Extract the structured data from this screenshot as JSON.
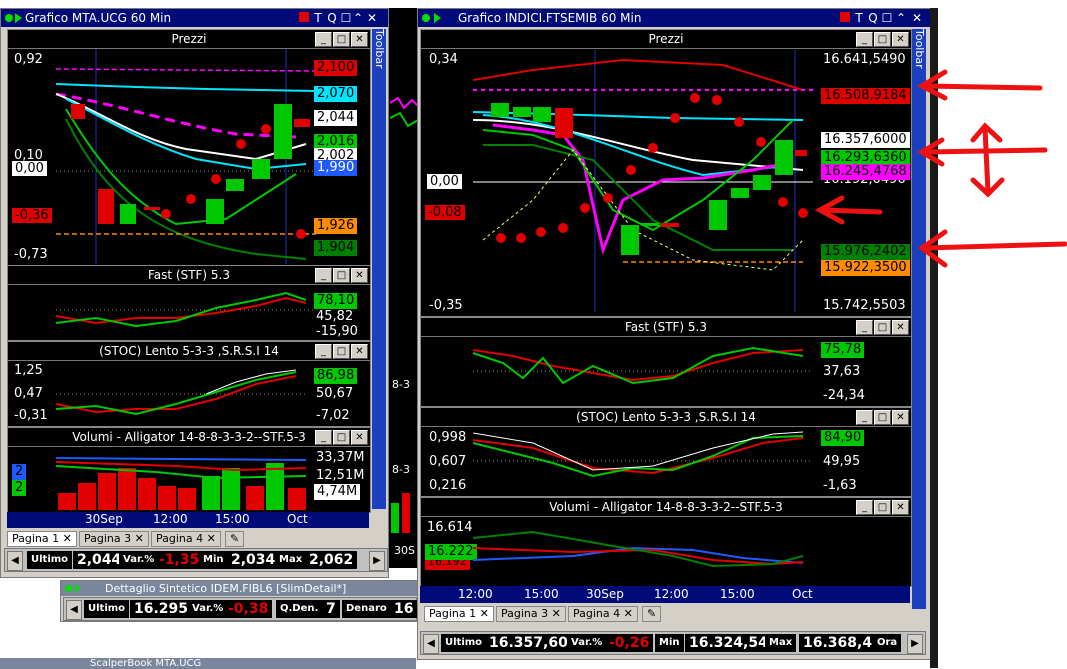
{
  "left_window": {
    "title": "Grafico MTA.UCG 60 Min",
    "title_buttons": [
      "T",
      "Q"
    ],
    "toolbar_label": "Toolbar",
    "price_pane": {
      "title": "Prezzi",
      "left_ticks": [
        "0,92",
        "0,10",
        "0,00",
        "-0,36",
        "-0,73"
      ],
      "right_tags": [
        {
          "text": "2,100",
          "bg": "#e00000",
          "fg": "#000000"
        },
        {
          "text": "2,070",
          "bg": "#00e5ff",
          "fg": "#000000"
        },
        {
          "text": "2,044",
          "bg": "#ffffff",
          "fg": "#000000"
        },
        {
          "text": "2,016",
          "bg": "#00c800",
          "fg": "#000000"
        },
        {
          "text": "2,002",
          "bg": "#ffffff",
          "fg": "#000000"
        },
        {
          "text": "1,990",
          "bg": "#1e5aff",
          "fg": "#ffffff"
        },
        {
          "text": "1,926",
          "bg": "#ff8c00",
          "fg": "#000000"
        },
        {
          "text": "1,904",
          "bg": "#008000",
          "fg": "#000000"
        }
      ]
    },
    "fast_pane": {
      "title": "Fast  (STF)   5.3",
      "right": [
        "78,10",
        "45,82",
        "-15,90"
      ]
    },
    "stoc_pane": {
      "title": "(STOC) Lento    5-3-3  ,S.R.S.I 14",
      "left": [
        "1,25",
        "0,47",
        "-0,31"
      ],
      "right": [
        "86,98",
        "50,67",
        "-7,02"
      ]
    },
    "vol_pane": {
      "title": "Volumi - Alligator 14-8-8-3-3-2--STF.5-3",
      "left": [
        "2",
        "2"
      ],
      "right": [
        "33,37M",
        "12,51M",
        "4,74M"
      ]
    },
    "x_labels": [
      "30Sep",
      "12:00",
      "15:00",
      "Oct"
    ],
    "tabs": [
      "Pagina 1",
      "Pagina 3",
      "Pagina 4"
    ],
    "status": {
      "ultimo_label": "Ultimo",
      "ultimo": "2,044",
      "var_label": "Var.%",
      "var": "-1,35",
      "min_label": "Min",
      "min": "2,034",
      "max_label": "Max",
      "max": "2,062"
    }
  },
  "right_window": {
    "title": "Grafico INDICI.FTSEMIB 60 Min",
    "title_buttons": [
      "T",
      "Q"
    ],
    "toolbar_label": "Toolbar",
    "price_pane": {
      "title": "Prezzi",
      "left_ticks": [
        "0,34",
        "0,00",
        "-0,08",
        "-0,35"
      ],
      "right_top": "16.641,5490",
      "right_bottom": "15.742,5503",
      "right_mid": "16.192,0496",
      "right_tags": [
        {
          "text": "16.508,9184",
          "bg": "#e00000",
          "fg": "#000000"
        },
        {
          "text": "16.357,6000",
          "bg": "#ffffff",
          "fg": "#000000"
        },
        {
          "text": "16.293,6360",
          "bg": "#00c800",
          "fg": "#000000"
        },
        {
          "text": "16.245,4768",
          "bg": "#ff00ff",
          "fg": "#000000"
        },
        {
          "text": "15.976,2402",
          "bg": "#008000",
          "fg": "#000000"
        },
        {
          "text": "15.922,3500",
          "bg": "#ff8c00",
          "fg": "#000000"
        }
      ]
    },
    "fast_pane": {
      "title": "Fast  (STF)   5.3",
      "right": [
        "75,78",
        "37,63",
        "-24,34"
      ]
    },
    "stoc_pane": {
      "title": "(STOC) Lento    5-3-3  ,S.R.S.I 14",
      "left": [
        "0,998",
        "0,607",
        "0,216"
      ],
      "right": [
        "84,90",
        "49,95",
        "-1,63"
      ]
    },
    "vol_pane": {
      "title": "Volumi - Alligator 14-8-8-3-3-2--STF.5-3",
      "left": [
        "16.614",
        "16.222",
        "16.192"
      ]
    },
    "x_labels": [
      "12:00",
      "15:00",
      "30Sep",
      "12:00",
      "15:00",
      "Oct"
    ],
    "tabs": [
      "Pagina 1",
      "Pagina 3",
      "Pagina 4"
    ],
    "status": {
      "ultimo_label": "Ultimo",
      "ultimo": "16.357,60",
      "var_label": "Var.%",
      "var": "-0,26",
      "min_label": "Min",
      "min": "16.324,54",
      "max_label": "Max",
      "max": "16.368,4",
      "ora_label": "Ora"
    }
  },
  "detail_window": {
    "title": "Dettaglio Sintetico IDEM.FIBL6 [SlimDetail*]",
    "ultimo_label": "Ultimo",
    "ultimo": "16.295",
    "var_label": "Var.%",
    "var": "-0,38",
    "qden_label": "Q.Den.",
    "qden": "7",
    "denaro_label": "Denaro",
    "denaro": "16"
  },
  "scalper_window": {
    "title": "ScalperBook MTA.UCG"
  },
  "middle_fragments": {
    "x_label": "30S",
    "label1": "8-3",
    "label2": "8-3",
    "label3": "3"
  }
}
